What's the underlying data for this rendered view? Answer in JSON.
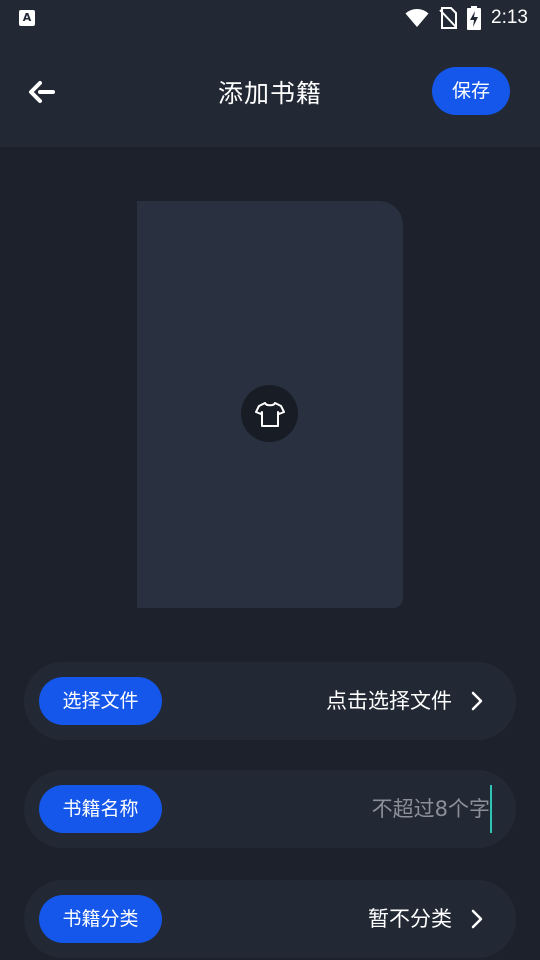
{
  "status_bar": {
    "time": "2:13",
    "left_icon_letter": "A",
    "icons": [
      "notification-a-icon",
      "wifi-icon",
      "no-sim-icon",
      "battery-charging-icon"
    ]
  },
  "header": {
    "title": "添加书籍",
    "save_label": "保存",
    "back_icon": "back-arrow-icon"
  },
  "cover": {
    "icon": "tshirt-icon"
  },
  "form": {
    "file": {
      "label": "选择文件",
      "value": "点击选择文件"
    },
    "name": {
      "label": "书籍名称",
      "placeholder": "不超过8个字",
      "value": ""
    },
    "category": {
      "label": "书籍分类",
      "value": "暂不分类"
    }
  },
  "colors": {
    "background": "#1c212b",
    "surface": "#232934",
    "card": "#293140",
    "accent": "#1457ea",
    "cursor": "#2ec4b6"
  }
}
